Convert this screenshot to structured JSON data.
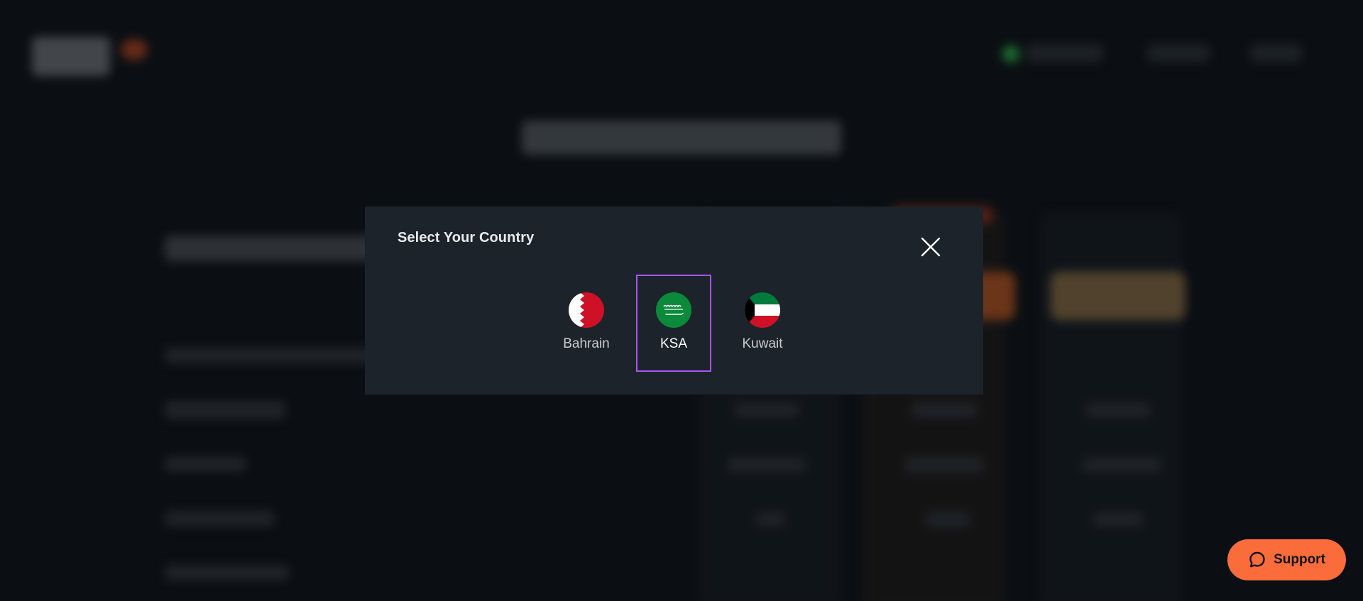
{
  "modal": {
    "title": "Select Your Country",
    "countries": [
      {
        "label": "Bahrain",
        "selected": false
      },
      {
        "label": "KSA",
        "selected": true
      },
      {
        "label": "Kuwait",
        "selected": false
      }
    ]
  },
  "support": {
    "label": "Support"
  },
  "colors": {
    "selected_border": "#a855f7",
    "support_bg": "#fb6c3b",
    "modal_bg": "#1d232a"
  }
}
